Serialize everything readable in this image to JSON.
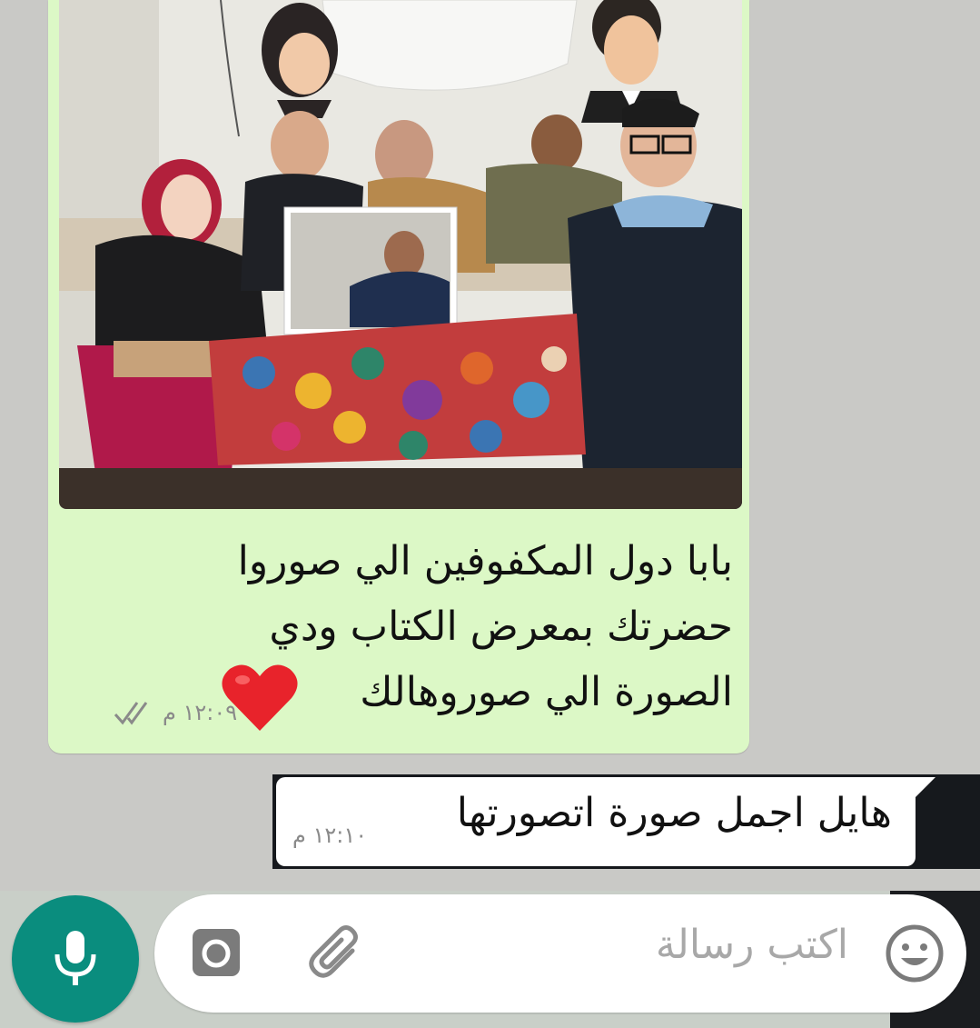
{
  "messages": {
    "outgoing": {
      "caption": "بابا دول المكفوفين الي صوروا حضرتك بمعرض الكتاب ودي الصورة الي صوروهالك",
      "time": "١٢:٠٩ م",
      "status": "read",
      "has_heart_emoji": true
    },
    "incoming": {
      "text": "هايل اجمل صورة اتصورتها",
      "time": "١٢:١٠ م"
    }
  },
  "composer": {
    "placeholder": "اكتب رسالة",
    "mic_icon": "microphone-icon",
    "camera_icon": "camera-icon",
    "attach_icon": "paperclip-icon",
    "emoji_icon": "smiley-icon"
  },
  "colors": {
    "outgoing_bubble": "#dcf8c6",
    "incoming_bubble": "#ffffff",
    "mic_button": "#0a8d7e",
    "read_ticks": "#8a8a8a"
  }
}
